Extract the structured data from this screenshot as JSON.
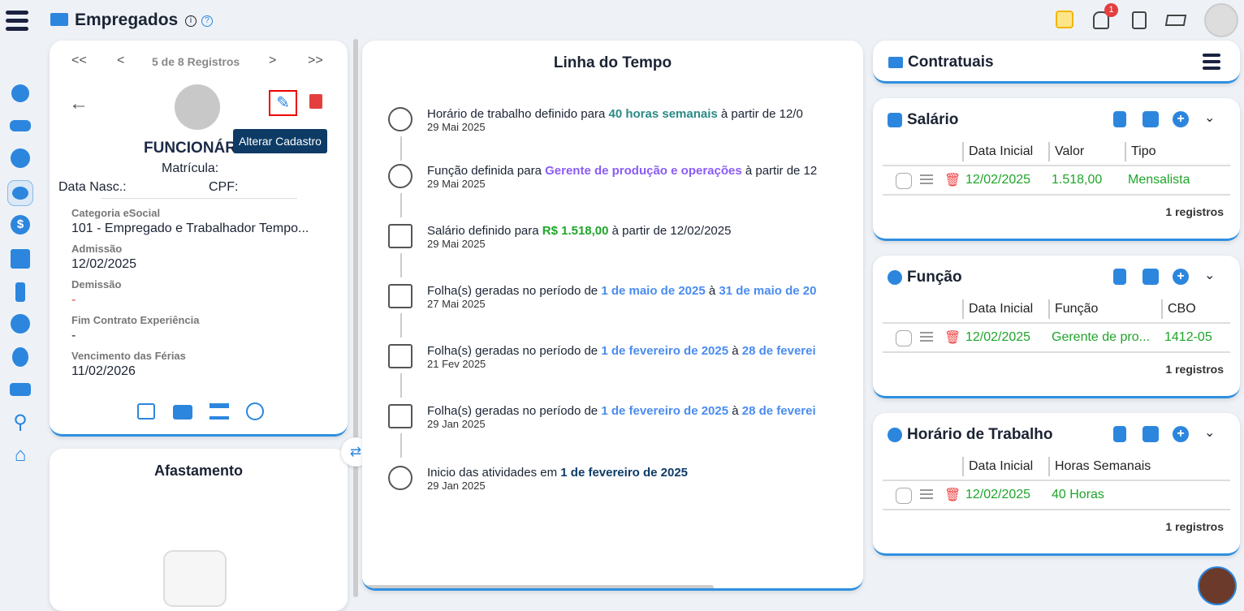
{
  "header": {
    "title": "Empregados",
    "notif_count": "1"
  },
  "record_nav": {
    "first": "<<",
    "prev": "<",
    "counter": "5 de 8 Registros",
    "next": ">",
    "last": ">>"
  },
  "employee": {
    "name": "FUNCIONÁR",
    "matricula_label": "Matrícula:",
    "nasc_label": "Data Nasc.:",
    "cpf_label": "CPF:",
    "fields": [
      {
        "label": "Categoria eSocial",
        "value": "101 - Empregado e Trabalhador Tempo..."
      },
      {
        "label": "Admissão",
        "value": "12/02/2025"
      },
      {
        "label": "Demissão",
        "value": "-"
      },
      {
        "label": "Fim Contrato Experiência",
        "value": "-"
      },
      {
        "label": "Vencimento das Férias",
        "value": "11/02/2026"
      }
    ]
  },
  "tooltip": "Alterar Cadastro",
  "afastamento": {
    "title": "Afastamento"
  },
  "timeline": {
    "title": "Linha do Tempo",
    "items": [
      {
        "pre": "Horário de trabalho definido para ",
        "hl": "40 horas semanais",
        "mid": " à partir de 12/0",
        "hl2": "",
        "date": "29 Mai 2025"
      },
      {
        "pre": "Função definida para ",
        "hl": "Gerente de produção e operações",
        "mid": " à partir de 12",
        "hl2": "",
        "date": "29 Mai 2025"
      },
      {
        "pre": "Salário definido para ",
        "hl": "R$ 1.518,00",
        "mid": " à partir de 12/02/2025",
        "hl2": "",
        "date": "29 Mai 2025"
      },
      {
        "pre": "Folha(s) geradas no período de ",
        "hl": "1 de maio de 2025",
        "mid": " à ",
        "hl2": "31 de maio de 20",
        "date": "27 Mai 2025"
      },
      {
        "pre": "Folha(s) geradas no período de ",
        "hl": "1 de fevereiro de 2025",
        "mid": " à ",
        "hl2": "28 de feverei",
        "date": "21 Fev 2025"
      },
      {
        "pre": "Folha(s) geradas no período de ",
        "hl": "1 de fevereiro de 2025",
        "mid": " à ",
        "hl2": "28 de feverei",
        "date": "29 Jan 2025"
      },
      {
        "pre": "Inicio das atividades em ",
        "hl": "1 de fevereiro de 2025",
        "mid": "",
        "hl2": "",
        "date": "29 Jan 2025"
      }
    ]
  },
  "contratuais": {
    "title": "Contratuais"
  },
  "sections": [
    {
      "title": "Salário",
      "headers": [
        "Data Inicial",
        "Valor",
        "Tipo"
      ],
      "row": [
        "12/02/2025",
        "1.518,00",
        "Mensalista"
      ],
      "count": "1 registros"
    },
    {
      "title": "Função",
      "headers": [
        "Data Inicial",
        "Função",
        "CBO"
      ],
      "row": [
        "12/02/2025",
        "Gerente de pro...",
        "1412-05"
      ],
      "count": "1 registros"
    },
    {
      "title": "Horário de Trabalho",
      "headers": [
        "Data Inicial",
        "Horas Semanais"
      ],
      "row": [
        "12/02/2025",
        "40 Horas"
      ],
      "count": "1 registros"
    }
  ],
  "colors": {
    "accent": "#2c86de",
    "teal": "#2a8a86",
    "purple": "#8b5cf6",
    "green": "#1fa52a",
    "link": "#4a8cf0",
    "navy": "#0d3b66",
    "danger": "#e53e3e"
  }
}
